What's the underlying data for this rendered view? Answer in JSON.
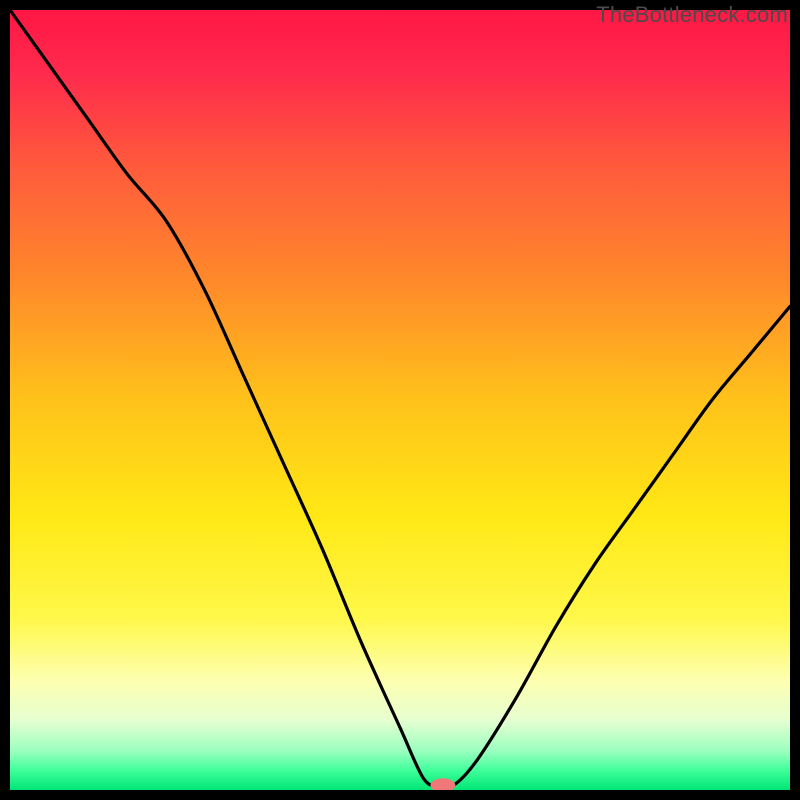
{
  "watermark": "TheBottleneck.com",
  "colors": {
    "gradient_stops": [
      {
        "offset": 0.0,
        "color": "#ff1744"
      },
      {
        "offset": 0.08,
        "color": "#ff2a4d"
      },
      {
        "offset": 0.2,
        "color": "#ff5a3c"
      },
      {
        "offset": 0.35,
        "color": "#ff8a2a"
      },
      {
        "offset": 0.5,
        "color": "#ffc21a"
      },
      {
        "offset": 0.65,
        "color": "#ffe815"
      },
      {
        "offset": 0.78,
        "color": "#fff84a"
      },
      {
        "offset": 0.86,
        "color": "#fdffb0"
      },
      {
        "offset": 0.91,
        "color": "#e6ffd0"
      },
      {
        "offset": 0.95,
        "color": "#9bffc0"
      },
      {
        "offset": 0.975,
        "color": "#3fff9a"
      },
      {
        "offset": 1.0,
        "color": "#00e676"
      }
    ],
    "curve": "#000000",
    "marker": "#f07878",
    "frame": "#000000"
  },
  "chart_data": {
    "type": "line",
    "title": "",
    "xlabel": "",
    "ylabel": "",
    "xlim": [
      0,
      100
    ],
    "ylim": [
      0,
      100
    ],
    "grid": false,
    "series": [
      {
        "name": "bottleneck-curve",
        "x": [
          0,
          5,
          10,
          15,
          20,
          25,
          30,
          35,
          40,
          45,
          50,
          53,
          55,
          57,
          60,
          65,
          70,
          75,
          80,
          85,
          90,
          95,
          100
        ],
        "values": [
          100,
          93,
          86,
          79,
          73,
          64,
          53,
          42,
          31,
          19,
          8,
          1.5,
          0.5,
          0.7,
          4,
          12,
          21,
          29,
          36,
          43,
          50,
          56,
          62
        ]
      }
    ],
    "marker": {
      "x": 55.5,
      "y": 0.6,
      "rx": 1.6,
      "ry": 0.9
    },
    "annotations": []
  }
}
